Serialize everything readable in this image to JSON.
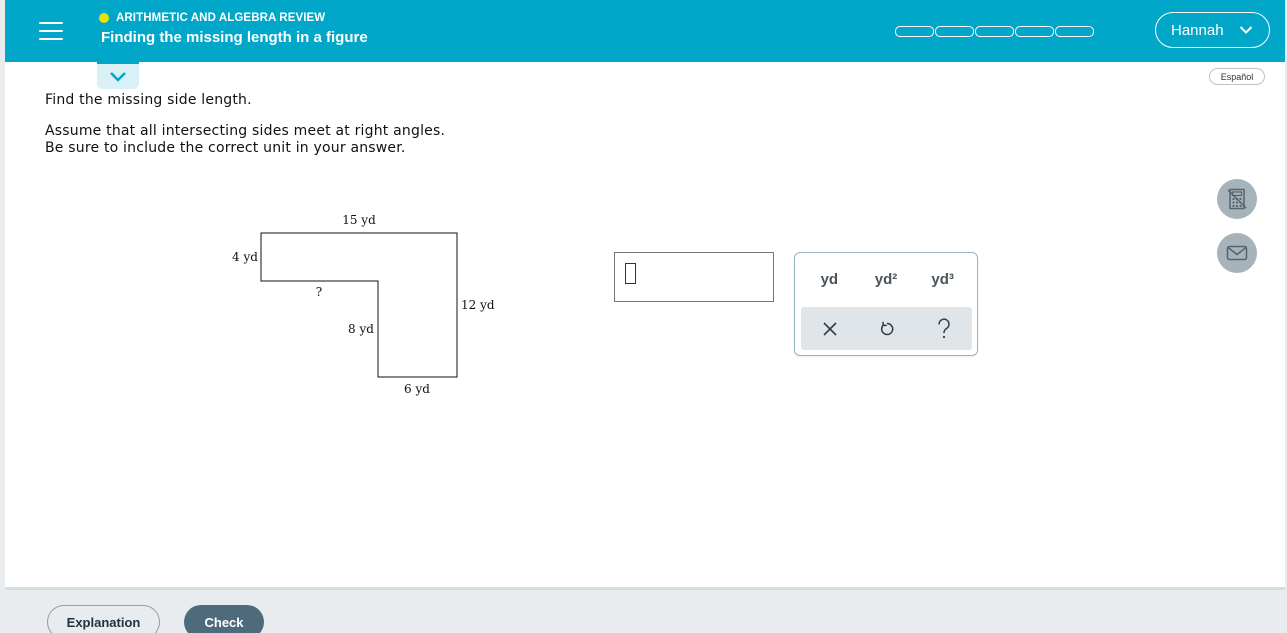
{
  "header": {
    "topic": "ARITHMETIC AND ALGEBRA REVIEW",
    "title": "Finding the missing length in a figure",
    "progress_segments": 5,
    "progress_filled": 0,
    "user_name": "Hannah",
    "colors": {
      "bar": "#00a7c8",
      "topic_dot": "#e7e500"
    }
  },
  "main": {
    "language_link": "Español",
    "instructions": {
      "line1": "Find the missing side length.",
      "line2": "Assume that all intersecting sides meet at right angles.",
      "line3": "Be sure to include the correct unit in your answer."
    },
    "figure": {
      "top": "15 yd",
      "left": "4 yd",
      "missing": "?",
      "inner": "8 yd",
      "right": "12 yd",
      "bottom": "6 yd"
    },
    "answer": {
      "value": ""
    },
    "keypad": {
      "units": [
        "yd",
        "yd²",
        "yd³"
      ],
      "actions": [
        "clear-icon",
        "undo-icon",
        "help-icon"
      ]
    },
    "side_tools": [
      "calculator-icon",
      "mail-icon"
    ]
  },
  "footer": {
    "explanation_label": "Explanation",
    "check_label": "Check"
  }
}
